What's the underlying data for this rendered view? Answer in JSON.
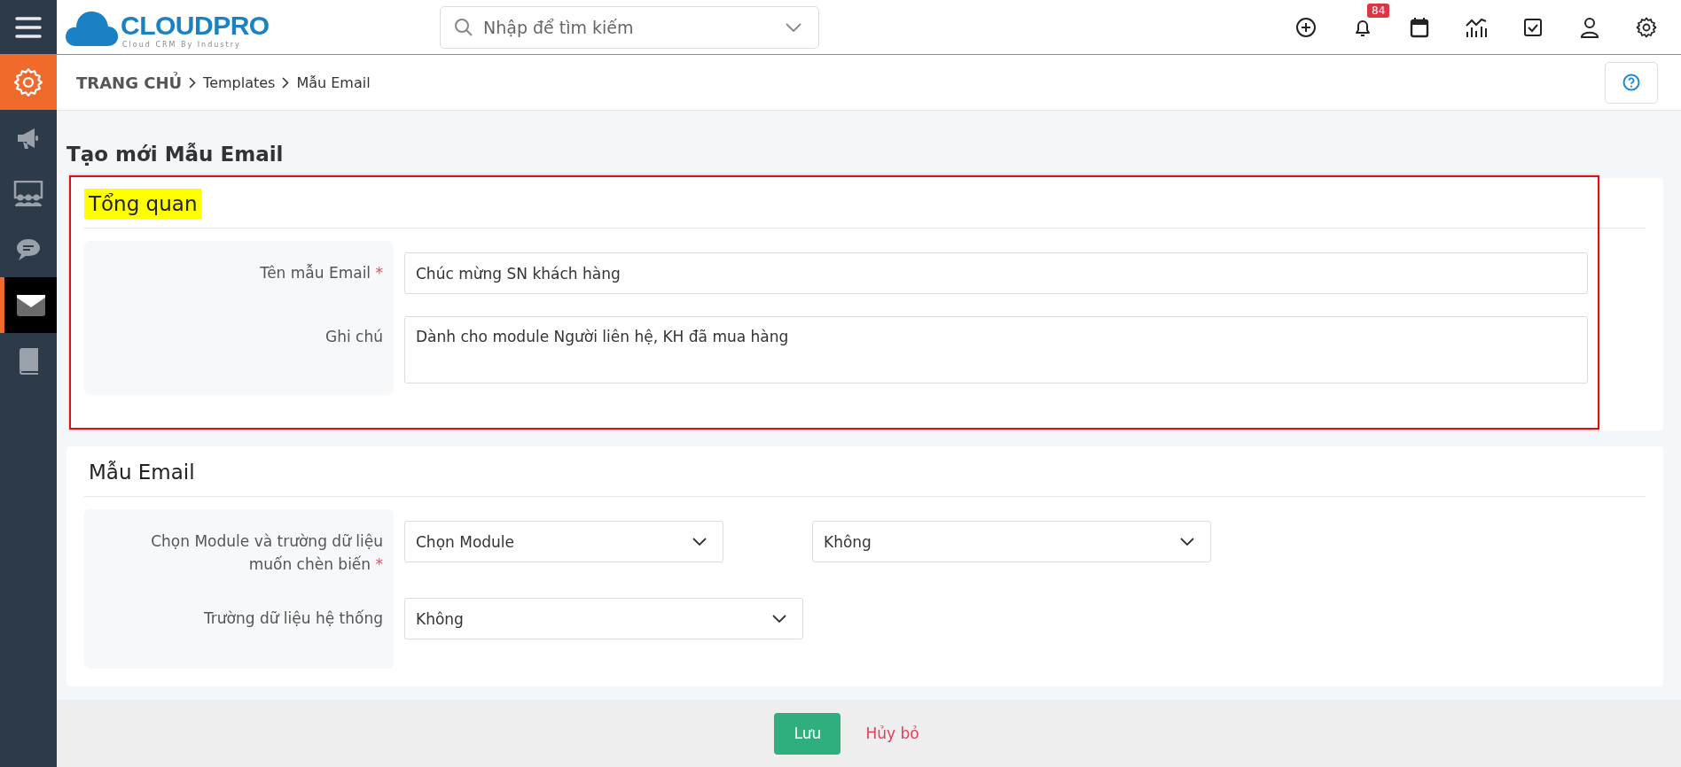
{
  "logo": {
    "name": "CLOUDPRO",
    "tagline": "Cloud CRM By Industry"
  },
  "search": {
    "placeholder": "Nhập để tìm kiếm"
  },
  "header": {
    "notification_count": "84"
  },
  "sidebar": {
    "items": [
      {
        "selected": false
      },
      {
        "selected": false
      },
      {
        "selected": false
      },
      {
        "selected": true
      },
      {
        "selected": false
      }
    ]
  },
  "breadcrumb": [
    "TRANG CHỦ",
    "Templates",
    "Mẫu Email"
  ],
  "page_title": "Tạo mới Mẫu Email",
  "sections": [
    {
      "title": "Tổng quan",
      "highlighted": true,
      "rows": [
        {
          "label": "Tên mẫu Email",
          "required_mark": "*",
          "fields": [
            {
              "kind": "input",
              "value": "Chúc mừng SN khách hàng"
            }
          ]
        },
        {
          "label": "Ghi chú",
          "fields": [
            {
              "kind": "textarea",
              "value": "Dành cho module Người liên hệ, KH đã mua hàng"
            }
          ]
        }
      ]
    },
    {
      "title": "Mẫu Email",
      "highlighted": false,
      "rows": [
        {
          "label": "Chọn Module và trường dữ liệu muốn chèn biến",
          "required_mark": "*",
          "fields": [
            {
              "kind": "select",
              "value": "Chọn Module"
            },
            {
              "kind": "select",
              "value": "Không"
            }
          ]
        },
        {
          "label": "Trường dữ liệu hệ thống",
          "fields": [
            {
              "kind": "select",
              "value": "Không"
            }
          ]
        }
      ]
    }
  ],
  "footer": {
    "save": "Lưu",
    "cancel": "Hủy bỏ"
  }
}
